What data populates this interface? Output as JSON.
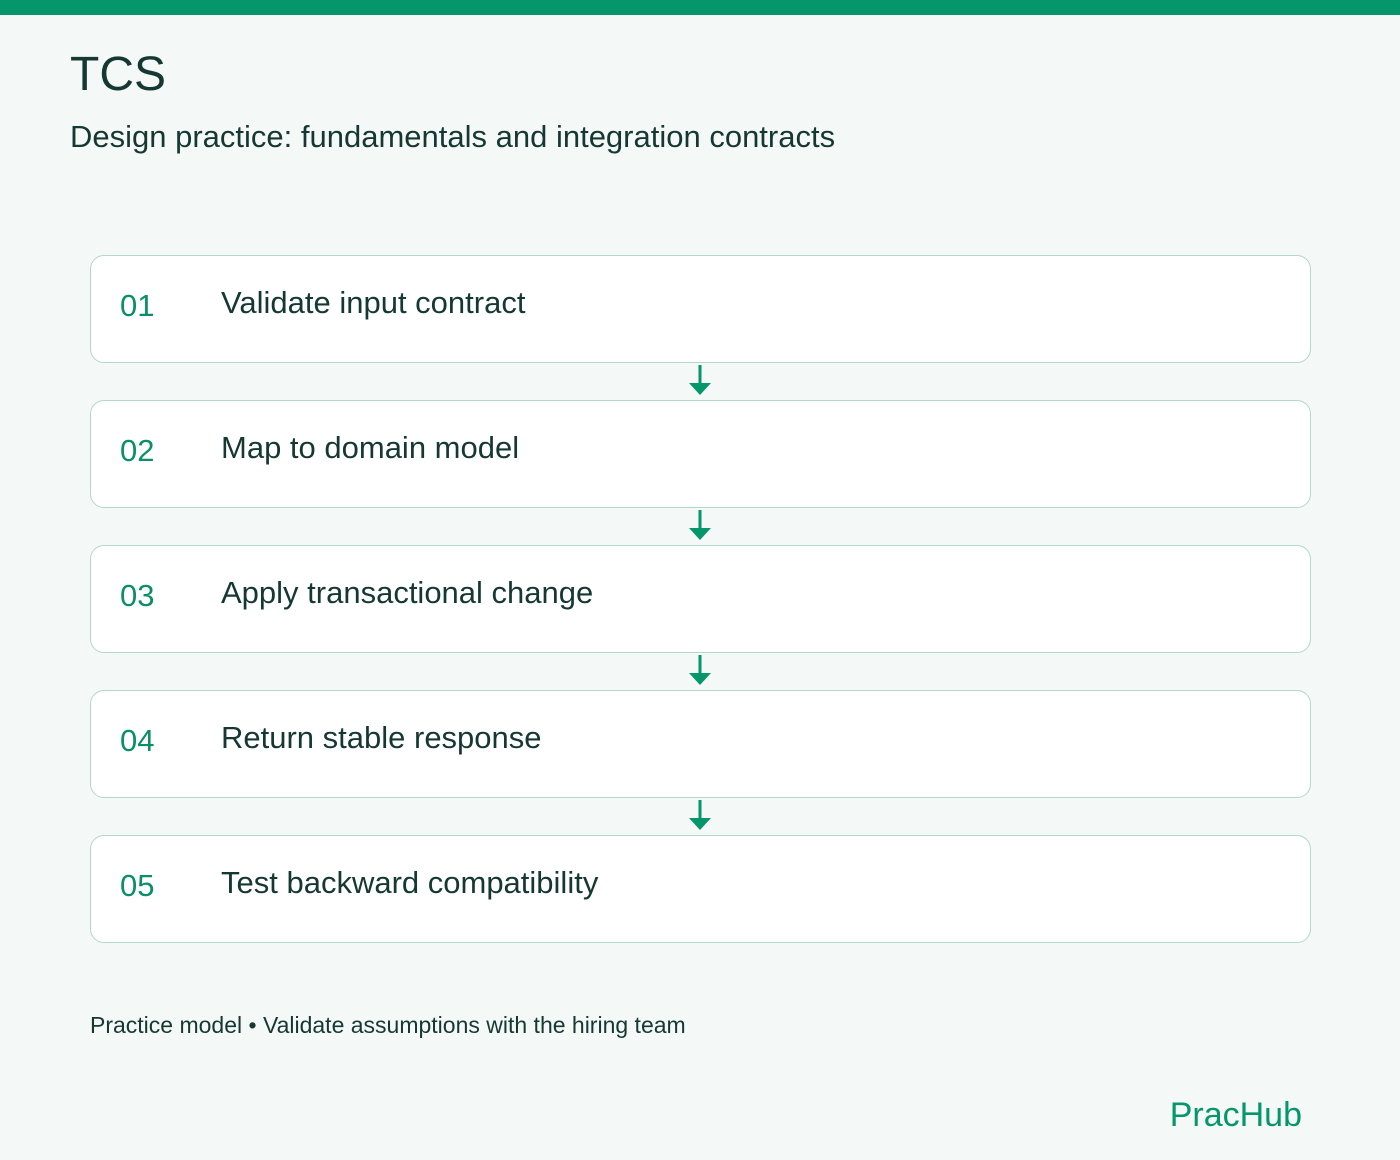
{
  "header": {
    "title": "TCS",
    "subtitle": "Design practice: fundamentals and integration contracts"
  },
  "steps": [
    {
      "number": "01",
      "label": "Validate input contract"
    },
    {
      "number": "02",
      "label": "Map to domain model"
    },
    {
      "number": "03",
      "label": "Apply transactional change"
    },
    {
      "number": "04",
      "label": "Return stable response"
    },
    {
      "number": "05",
      "label": "Test backward compatibility"
    }
  ],
  "footer": {
    "note": "Practice model • Validate assumptions with the hiring team",
    "brand": "PracHub"
  },
  "colors": {
    "accent": "#06966b",
    "text": "#163832",
    "card_border": "#b3d8cb",
    "background": "#f4f8f6"
  },
  "icons": {
    "connector": "arrow-down-icon"
  }
}
